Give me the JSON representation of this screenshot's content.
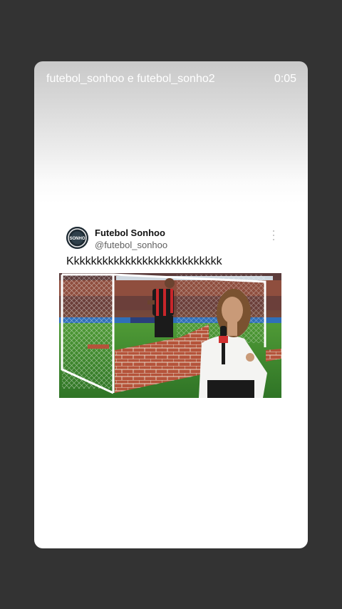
{
  "story": {
    "title": "futebol_sonhoo e futebol_sonho2",
    "time": "0:05"
  },
  "tweet": {
    "avatar_label": "SONHO",
    "display_name": "Futebol Sonhoo",
    "handle": "@futebol_sonhoo",
    "text": "Kkkkkkkkkkkkkkkkkkkkkkkkkkk",
    "more_icon": "more-vertical-icon",
    "media_description_icon": "video-frame"
  },
  "colors": {
    "page_background": "#333333",
    "card_background": "#ffffff",
    "pitch_green": "#3e8a2e",
    "brick": "#b5533a"
  }
}
